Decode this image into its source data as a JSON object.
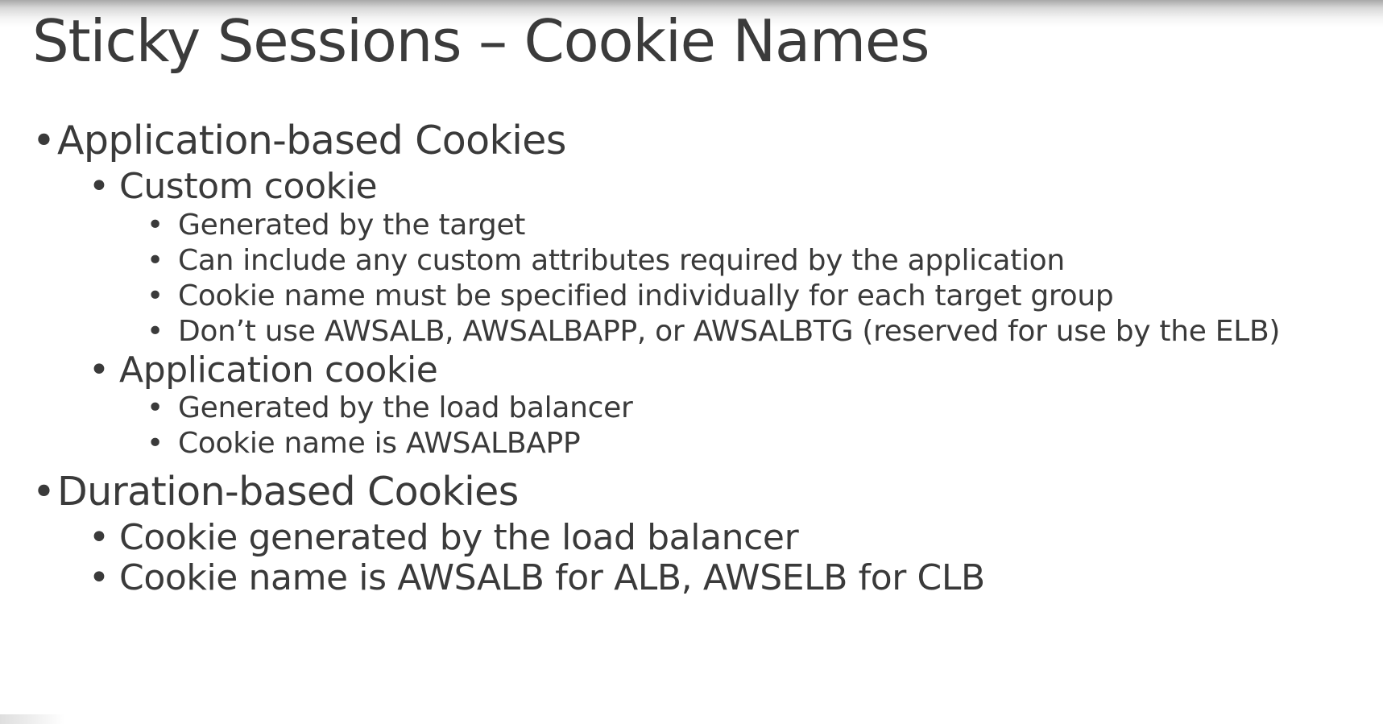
{
  "title": "Sticky Sessions – Cookie Names",
  "bullet_glyph": "•",
  "sections": [
    {
      "heading": "Application-based Cookies",
      "groups": [
        {
          "label": "Custom cookie",
          "items": [
            "Generated by the target",
            "Can include any custom attributes required by the application",
            "Cookie name must be specified individually for each target group"
          ],
          "reserved_item": {
            "prefix": "Don’t use ",
            "name1": "AWSALB",
            "sep1": ", ",
            "name2": "AWSALBAPP",
            "sep2": ", or ",
            "name3": "AWSALBTG",
            "suffix": " (reserved for use by the ELB)"
          }
        },
        {
          "label": "Application cookie",
          "items": [
            "Generated by the load balancer"
          ],
          "name_item": {
            "prefix": "Cookie name is ",
            "name": "AWSALBAPP"
          }
        }
      ]
    },
    {
      "heading": "Duration-based Cookies",
      "items": [
        "Cookie generated by the load balancer"
      ],
      "name_item": {
        "prefix": "Cookie name is ",
        "name1": "AWSALB",
        "mid": " for ALB, ",
        "name2": "AWSELB",
        "suffix": " for CLB"
      }
    }
  ]
}
